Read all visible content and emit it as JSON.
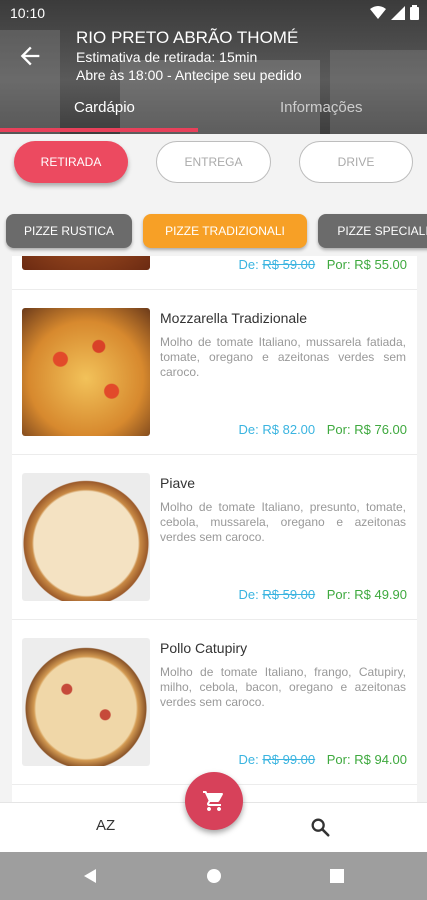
{
  "status": {
    "time": "10:10"
  },
  "header": {
    "store_name": "RIO PRETO ABRÃO THOMÉ",
    "pickup_estimate": "Estimativa de retirada: 15min",
    "opening": "Abre às 18:00 - Antecipe seu pedido",
    "tabs": [
      {
        "label": "Cardápio"
      },
      {
        "label": "Informações"
      }
    ],
    "accent": "#e8405a"
  },
  "modes": [
    {
      "label": "RETIRADA"
    },
    {
      "label": "ENTREGA"
    },
    {
      "label": "DRIVE"
    }
  ],
  "categories": [
    {
      "label": "PIZZE RUSTICA"
    },
    {
      "label": "PIZZE TRADIZIONALI"
    },
    {
      "label": "PIZZE SPECIALI"
    }
  ],
  "products": [
    {
      "name": "",
      "description": "",
      "de_label": "De:",
      "de_price": "R$ 59.00",
      "por_label": "Por:",
      "por_price": "R$ 55.00"
    },
    {
      "name": "Mozzarella Tradizionale",
      "description": "Molho de tomate Italiano, mussarela fatiada, tomate, oregano e azeitonas verdes sem caroco.",
      "de_label": "De:",
      "de_price": "R$ 82.00",
      "por_label": "Por:",
      "por_price": "R$ 76.00"
    },
    {
      "name": "Piave",
      "description": "Molho de tomate Italiano, presunto, tomate, cebola, mussarela, oregano e azeitonas verdes sem caroco.",
      "de_label": "De:",
      "de_price": "R$ 59.00",
      "por_label": "Por:",
      "por_price": "R$ 49.90"
    },
    {
      "name": "Pollo Catupiry",
      "description": "Molho de tomate Italiano, frango, Catupiry, milho, cebola, bacon, oregano e azeitonas verdes sem caroco.",
      "de_label": "De:",
      "de_price": "R$ 99.00",
      "por_label": "Por:",
      "por_price": "R$ 94.00"
    }
  ],
  "bottom": {
    "sort_label": "AZ"
  },
  "icons": [
    "back-arrow-icon",
    "wifi-icon",
    "signal-icon",
    "battery-icon",
    "cart-icon",
    "search-icon",
    "nav-back-icon",
    "nav-home-icon",
    "nav-recents-icon"
  ],
  "colors": {
    "retirada": "#ec4a60",
    "category_active": "#f7a026",
    "price_de": "#3ab4e0",
    "price_por": "#3ea93e",
    "cart": "#d7415a"
  }
}
